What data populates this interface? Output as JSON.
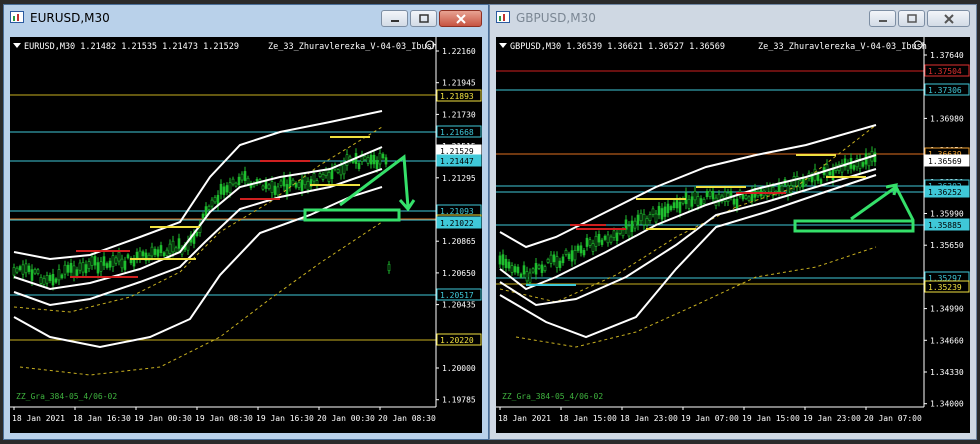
{
  "windows": [
    {
      "title": "EURUSD,M30",
      "info": "EURUSD,M30  1.21482 1.21535 1.21473 1.21529",
      "indicator": "Ze_33_Zhuravlerezka_V-04-03_Ibush",
      "zz_label": "ZZ_Gra_384-05_4/06-02",
      "price_axis": [
        "1.22160",
        "1.21945",
        "1.21730",
        "1.21515",
        "1.21295",
        "1.21080",
        "1.20865",
        "1.20650",
        "1.20435",
        "1.20220",
        "1.20000",
        "1.19785"
      ],
      "price_labels": [
        {
          "text": "1.21893",
          "color": "#f0e040",
          "kind": "yellow"
        },
        {
          "text": "1.21668",
          "color": "#3fc8d8",
          "kind": "cyan"
        },
        {
          "text": "1.21529",
          "color": "#ffffff",
          "kind": "current"
        },
        {
          "text": "1.21447",
          "color": "#3fc8d8",
          "kind": "cyanfill"
        },
        {
          "text": "1.21093",
          "color": "#3fc8d8",
          "kind": "cyan"
        },
        {
          "text": "1.21056",
          "color": "#f0e040",
          "kind": "orange"
        },
        {
          "text": "1.21022",
          "color": "#3fc8d8",
          "kind": "cyanfill"
        },
        {
          "text": "1.20517",
          "color": "#3fc8d8",
          "kind": "cyan"
        },
        {
          "text": "1.20220",
          "color": "#f0e040",
          "kind": "yellow"
        }
      ],
      "time_axis": [
        "18 Jan 2021",
        "18 Jan 16:30",
        "19 Jan 00:30",
        "19 Jan 08:30",
        "19 Jan 16:30",
        "20 Jan 00:30",
        "20 Jan 08:30"
      ]
    },
    {
      "title": "GBPUSD,M30",
      "info": "GBPUSD,M30  1.36539 1.36621 1.36527 1.36569",
      "indicator": "Ze_33_Zhuravlerezka_V-04-03_Ibush",
      "zz_label": "ZZ_Gra_384-05_4/06-02",
      "price_axis": [
        "1.37640",
        "1.37310",
        "1.36980",
        "1.36650",
        "1.36320",
        "1.35990",
        "1.35650",
        "1.35320",
        "1.34990",
        "1.34660",
        "1.34330",
        "1.34000"
      ],
      "price_labels": [
        {
          "text": "1.37504",
          "color": "#e03030",
          "kind": "red"
        },
        {
          "text": "1.37306",
          "color": "#3fc8d8",
          "kind": "cyan"
        },
        {
          "text": "1.36639",
          "color": "#f0a030",
          "kind": "orange"
        },
        {
          "text": "1.36569",
          "color": "#ffffff",
          "kind": "current"
        },
        {
          "text": "1.36302",
          "color": "#3fc8d8",
          "kind": "cyan"
        },
        {
          "text": "1.36252",
          "color": "#3fc8d8",
          "kind": "cyanfill"
        },
        {
          "text": "1.35885",
          "color": "#3fc8d8",
          "kind": "cyanfill"
        },
        {
          "text": "1.35297",
          "color": "#3fc8d8",
          "kind": "cyan"
        },
        {
          "text": "1.35239",
          "color": "#f0e040",
          "kind": "yellow"
        }
      ],
      "time_axis": [
        "18 Jan 2021",
        "18 Jan 15:00",
        "18 Jan 23:00",
        "19 Jan 07:00",
        "19 Jan 15:00",
        "19 Jan 23:00",
        "20 Jan 07:00"
      ]
    }
  ]
}
